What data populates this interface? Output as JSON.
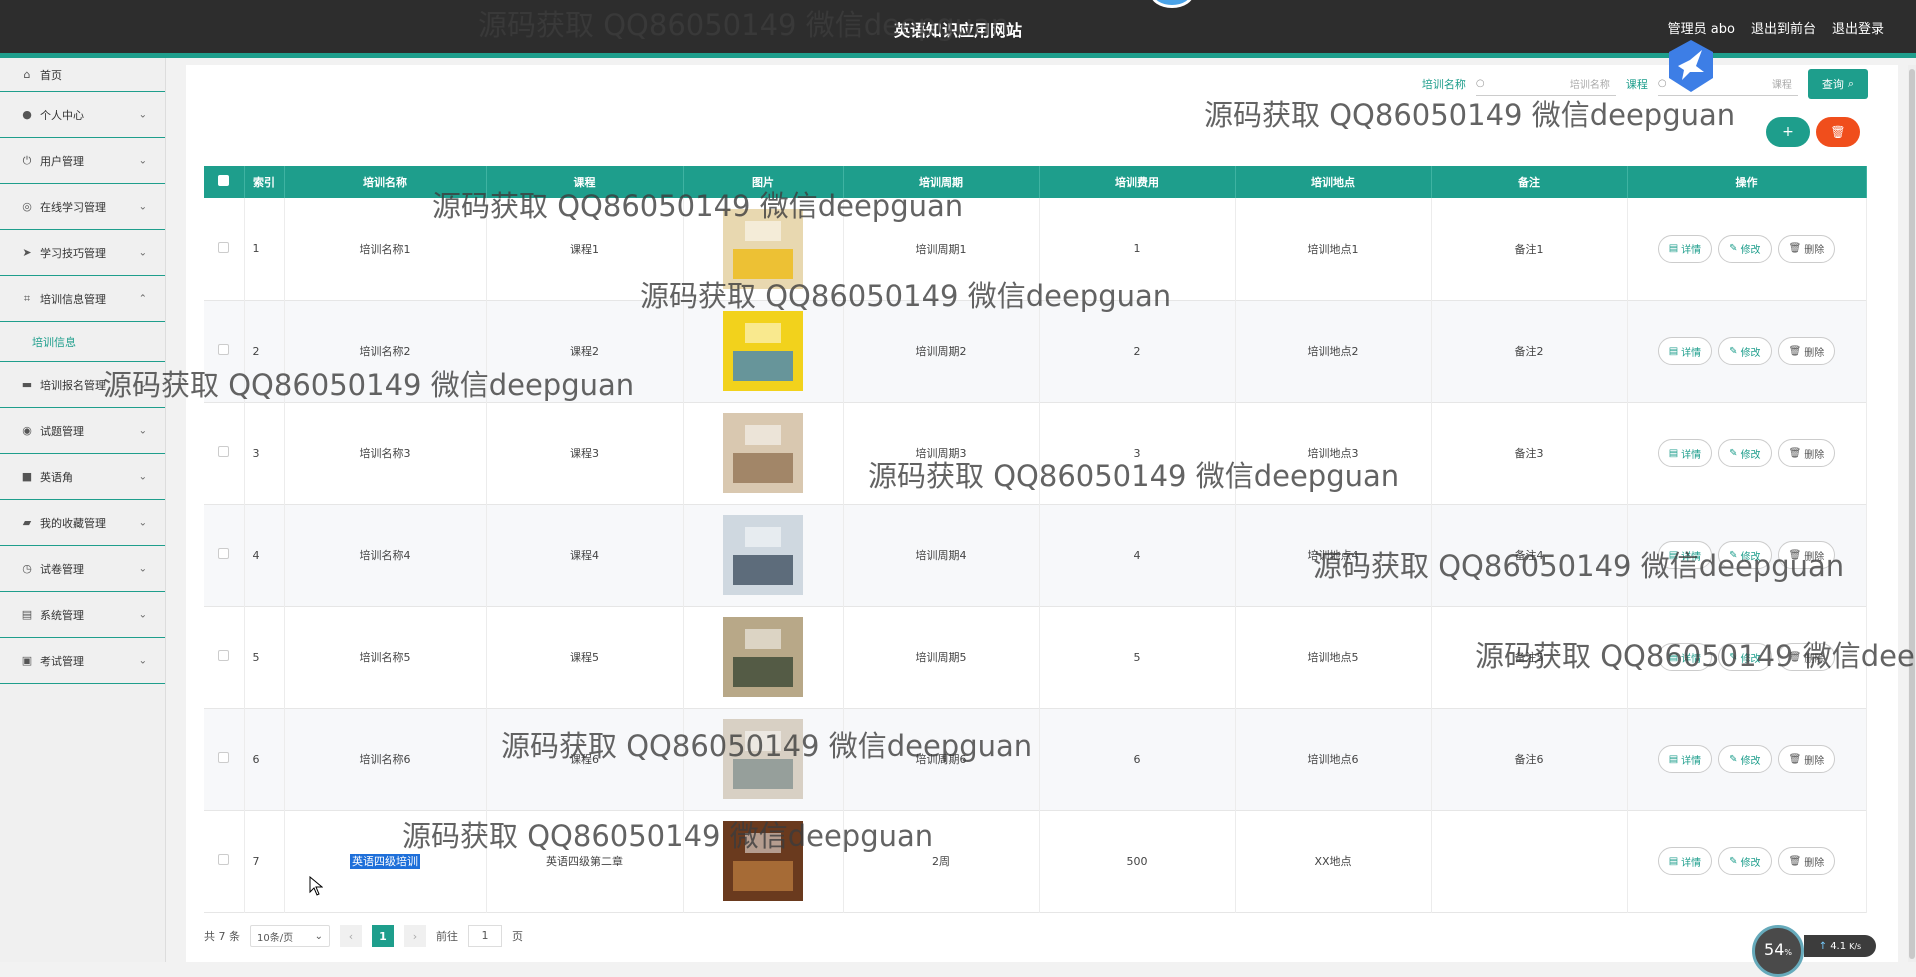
{
  "header": {
    "title": "英语知识应用网站",
    "links": [
      "管理员 abo",
      "退出到前台",
      "退出登录"
    ]
  },
  "sidebar": {
    "items": [
      {
        "label": "首页",
        "icon": "home-icon"
      },
      {
        "label": "个人中心",
        "icon": "user-icon"
      },
      {
        "label": "用户管理",
        "icon": "power-icon"
      },
      {
        "label": "在线学习管理",
        "icon": "compass-icon"
      },
      {
        "label": "学习技巧管理",
        "icon": "send-icon"
      },
      {
        "label": "培训信息管理",
        "icon": "crop-icon"
      },
      {
        "label": "培训报名管理",
        "icon": "comment-icon"
      },
      {
        "label": "试题管理",
        "icon": "target-icon"
      },
      {
        "label": "英语角",
        "icon": "briefcase-icon"
      },
      {
        "label": "我的收藏管理",
        "icon": "folder-icon"
      },
      {
        "label": "试卷管理",
        "icon": "clock-icon"
      },
      {
        "label": "系统管理",
        "icon": "clipboard-icon"
      },
      {
        "label": "考试管理",
        "icon": "clipboard-check-icon"
      }
    ],
    "sub_item": "培训信息"
  },
  "search": {
    "label1": "培训名称",
    "placeholder1": "培训名称",
    "label2": "课程",
    "placeholder2": "课程",
    "button": "查询"
  },
  "table": {
    "headers": [
      "索引",
      "培训名称",
      "课程",
      "图片",
      "培训周期",
      "培训费用",
      "培训地点",
      "备注",
      "操作"
    ],
    "rows": [
      {
        "idx": "1",
        "name": "培训名称1",
        "course": "课程1",
        "period": "培训周期1",
        "fee": "1",
        "place": "培训地点1",
        "note": "备注1"
      },
      {
        "idx": "2",
        "name": "培训名称2",
        "course": "课程2",
        "period": "培训周期2",
        "fee": "2",
        "place": "培训地点2",
        "note": "备注2"
      },
      {
        "idx": "3",
        "name": "培训名称3",
        "course": "课程3",
        "period": "培训周期3",
        "fee": "3",
        "place": "培训地点3",
        "note": "备注3"
      },
      {
        "idx": "4",
        "name": "培训名称4",
        "course": "课程4",
        "period": "培训周期4",
        "fee": "4",
        "place": "培训地点4",
        "note": "备注4"
      },
      {
        "idx": "5",
        "name": "培训名称5",
        "course": "课程5",
        "period": "培训周期5",
        "fee": "5",
        "place": "培训地点5",
        "note": "备注5"
      },
      {
        "idx": "6",
        "name": "培训名称6",
        "course": "课程6",
        "period": "培训周期6",
        "fee": "6",
        "place": "培训地点6",
        "note": "备注6"
      },
      {
        "idx": "7",
        "name": "英语四级培训",
        "course": "英语四级第二章",
        "period": "2周",
        "fee": "500",
        "place": "XX地点",
        "note": ""
      }
    ],
    "ops": [
      "详情",
      "修改",
      "删除"
    ]
  },
  "pager": {
    "total": "共 7 条",
    "size": "10条/页",
    "current": "1",
    "goto_label": "前往",
    "goto_value": "1",
    "page_unit": "页"
  },
  "speed": {
    "percent": "54",
    "unit": "%",
    "rate": "4.1",
    "rate_unit": "K/s"
  },
  "watermark": "源码获取 QQ86050149 微信deepguan",
  "colors": {
    "accent": "#1e9e8c",
    "danger": "#f04e1c",
    "header": "#2d2d2d"
  }
}
